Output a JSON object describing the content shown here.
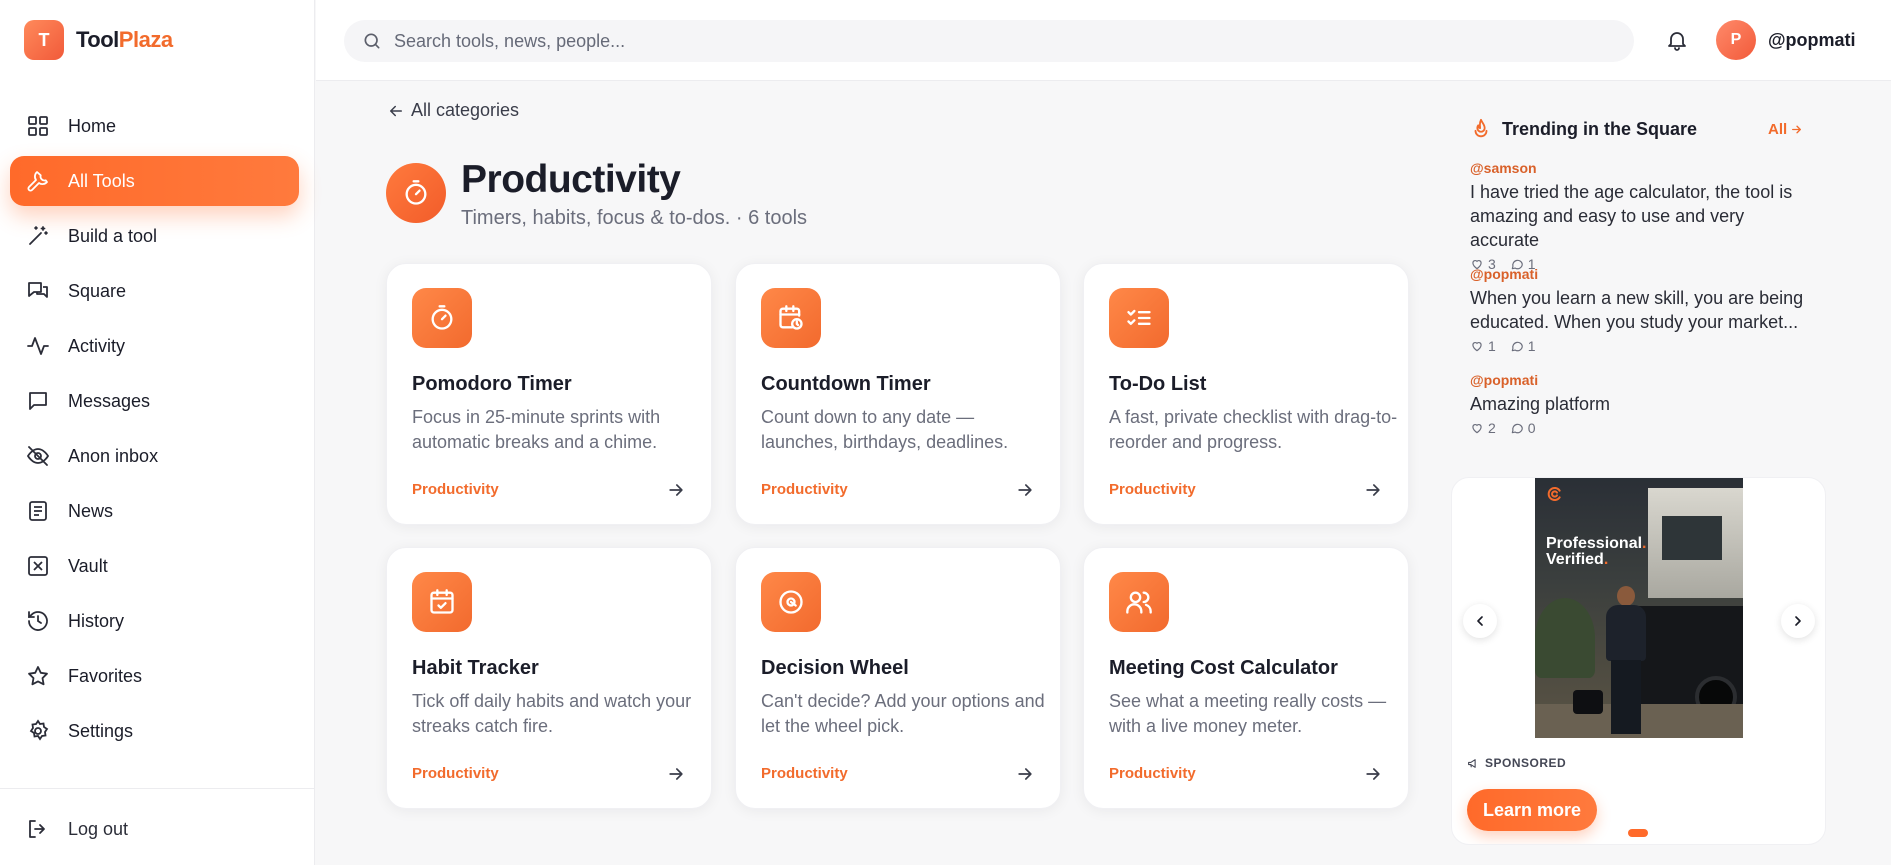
{
  "brand": {
    "logo_letter": "T",
    "name_part1": "Tool",
    "name_part2": "Plaza"
  },
  "sidebar": {
    "items": [
      {
        "label": "Home",
        "icon": "home-grid-icon"
      },
      {
        "label": "All Tools",
        "icon": "wrench-icon",
        "active": true
      },
      {
        "label": "Build a tool",
        "icon": "magic-wand-icon"
      },
      {
        "label": "Square",
        "icon": "chat-bubbles-icon"
      },
      {
        "label": "Activity",
        "icon": "activity-pulse-icon"
      },
      {
        "label": "Messages",
        "icon": "message-icon"
      },
      {
        "label": "Anon inbox",
        "icon": "eye-off-icon"
      },
      {
        "label": "News",
        "icon": "newspaper-icon"
      },
      {
        "label": "Vault",
        "icon": "vault-icon"
      },
      {
        "label": "History",
        "icon": "history-icon"
      },
      {
        "label": "Favorites",
        "icon": "star-icon"
      },
      {
        "label": "Settings",
        "icon": "gear-icon"
      }
    ],
    "logout_label": "Log out"
  },
  "topbar": {
    "search_placeholder": "Search tools, news, people...",
    "avatar_letter": "P",
    "username": "@popmati"
  },
  "main": {
    "back_label": "All categories",
    "category": {
      "title": "Productivity",
      "subtitle": "Timers, habits, focus & to-dos. · 6 tools"
    },
    "tools": [
      {
        "title": "Pomodoro Timer",
        "description": "Focus in 25-minute sprints with automatic breaks and a chime.",
        "tag": "Productivity",
        "icon": "timer-icon"
      },
      {
        "title": "Countdown Timer",
        "description": "Count down to any date — launches, birthdays, deadlines.",
        "tag": "Productivity",
        "icon": "calendar-clock-icon"
      },
      {
        "title": "To-Do List",
        "description": "A fast, private checklist with drag-to-reorder and progress.",
        "tag": "Productivity",
        "icon": "checklist-icon"
      },
      {
        "title": "Habit Tracker",
        "description": "Tick off daily habits and watch your streaks catch fire.",
        "tag": "Productivity",
        "icon": "calendar-check-icon"
      },
      {
        "title": "Decision Wheel",
        "description": "Can't decide? Add your options and let the wheel pick.",
        "tag": "Productivity",
        "icon": "wheel-icon"
      },
      {
        "title": "Meeting Cost Calculator",
        "description": "See what a meeting really costs — with a live money meter.",
        "tag": "Productivity",
        "icon": "users-icon"
      }
    ]
  },
  "trending": {
    "title": "Trending in the Square",
    "all_label": "All",
    "posts": [
      {
        "handle": "@samson",
        "text": "I have tried the age calculator, the tool is amazing and easy to use and very accurate",
        "likes": "3",
        "comments": "1"
      },
      {
        "handle": "@popmati",
        "text": "When you learn a new skill, you are being educated. When you study your market...",
        "likes": "1",
        "comments": "1"
      },
      {
        "handle": "@popmati",
        "text": "Amazing platform",
        "likes": "2",
        "comments": "0"
      }
    ]
  },
  "ad": {
    "headline_line1": "Professional",
    "headline_line2": "Verified",
    "sponsored_label": "SPONSORED",
    "cta_label": "Learn more"
  },
  "colors": {
    "accent": "#ff6a2a",
    "accent_text": "#f26b2c",
    "text": "#1b1d29",
    "muted": "#6b6e7c"
  }
}
